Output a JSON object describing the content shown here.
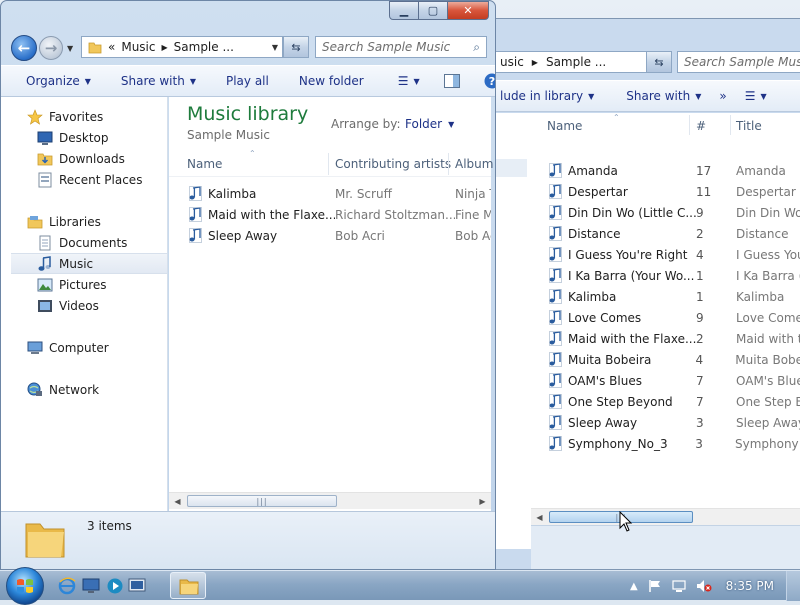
{
  "back_window": {
    "address": {
      "segment1": "usic",
      "segment2": "Sample ..."
    },
    "search_placeholder": "Search Sample Music",
    "toolbar": {
      "include": "lude in library",
      "share": "Share with",
      "more": "»"
    },
    "columns": {
      "name": "Name",
      "number": "#",
      "title": "Title"
    },
    "rows": [
      {
        "name": "Amanda",
        "num": "17",
        "title": "Amanda"
      },
      {
        "name": "Despertar",
        "num": "11",
        "title": "Despertar"
      },
      {
        "name": "Din Din Wo (Little C...",
        "num": "9",
        "title": "Din Din Wo"
      },
      {
        "name": "Distance",
        "num": "2",
        "title": "Distance"
      },
      {
        "name": "I Guess You're Right",
        "num": "4",
        "title": "I Guess You'"
      },
      {
        "name": "I Ka Barra (Your Wo...",
        "num": "1",
        "title": "I Ka Barra ("
      },
      {
        "name": "Kalimba",
        "num": "1",
        "title": "Kalimba"
      },
      {
        "name": "Love Comes",
        "num": "9",
        "title": "Love Comes"
      },
      {
        "name": "Maid with the Flaxe...",
        "num": "2",
        "title": "Maid with th"
      },
      {
        "name": "Muita Bobeira",
        "num": "4",
        "title": "Muita Bobeir"
      },
      {
        "name": "OAM's Blues",
        "num": "7",
        "title": "OAM's Blues"
      },
      {
        "name": "One Step Beyond",
        "num": "7",
        "title": "One Step Be"
      },
      {
        "name": "Sleep Away",
        "num": "3",
        "title": "Sleep Away"
      },
      {
        "name": "Symphony_No_3",
        "num": "3",
        "title": "Symphony N"
      }
    ]
  },
  "front_window": {
    "address": {
      "chevron": "«",
      "segment1": "Music",
      "segment2": "Sample ..."
    },
    "search_placeholder": "Search Sample Music",
    "toolbar": {
      "organize": "Organize",
      "share": "Share with",
      "play_all": "Play all",
      "new_folder": "New folder"
    },
    "sidebar": {
      "favorites": "Favorites",
      "desktop": "Desktop",
      "downloads": "Downloads",
      "recent": "Recent Places",
      "libraries": "Libraries",
      "documents": "Documents",
      "music": "Music",
      "pictures": "Pictures",
      "videos": "Videos",
      "computer": "Computer",
      "network": "Network"
    },
    "library_title": "Music library",
    "library_subtitle": "Sample Music",
    "arrange_by_label": "Arrange by:",
    "arrange_by_value": "Folder",
    "columns": {
      "name": "Name",
      "artists": "Contributing artists",
      "album": "Album"
    },
    "rows": [
      {
        "name": "Kalimba",
        "artist": "Mr. Scruff",
        "album": "Ninja T"
      },
      {
        "name": "Maid with the Flaxe...",
        "artist": "Richard Stoltzman...",
        "album": "Fine M"
      },
      {
        "name": "Sleep Away",
        "artist": "Bob Acri",
        "album": "Bob Ac"
      }
    ],
    "status": "3 items"
  },
  "taskbar": {
    "clock": "8:35 PM"
  },
  "colors": {
    "accent_green": "#1e7b3c",
    "link_blue": "#1e3287"
  }
}
